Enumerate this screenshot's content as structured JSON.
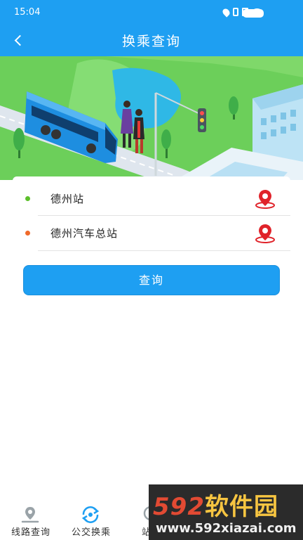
{
  "status_bar": {
    "time": "15:04",
    "battery": "battery-icon"
  },
  "header": {
    "title": "换乘查询",
    "back_icon": "back-arrow-icon"
  },
  "form": {
    "origin": {
      "value": "德州站",
      "dot_color": "#5cbf2a",
      "icon": "map-pin-icon"
    },
    "destination": {
      "value": "德州汽车总站",
      "dot_color": "#f06a2a",
      "icon": "map-pin-icon"
    },
    "query_label": "查询"
  },
  "bottom_nav": {
    "items": [
      {
        "label": "线路查询",
        "icon": "route-pin-icon",
        "active": false
      },
      {
        "label": "公交换乘",
        "icon": "transfer-icon",
        "active": true
      },
      {
        "label": "站点",
        "icon": "station-icon",
        "active": false
      }
    ]
  },
  "watermark": {
    "logo_num": "592",
    "logo_cn": "软件园",
    "url": "www.592xiazai.com"
  },
  "colors": {
    "primary": "#1e9ff2",
    "pin": "#e0232a",
    "green": "#5cbf2a",
    "orange": "#f06a2a"
  }
}
